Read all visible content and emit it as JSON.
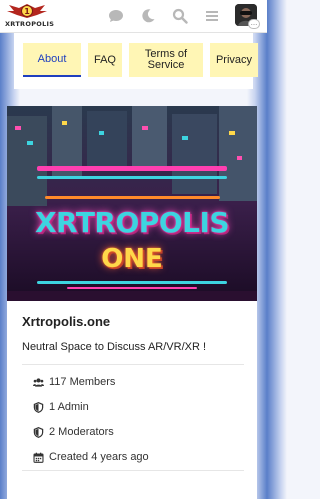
{
  "header": {
    "logo_text": "XRTROPOLIS",
    "icons": [
      "chat-icon",
      "moon-icon",
      "search-icon",
      "hamburger-menu-icon"
    ],
    "avatar_badge": "…"
  },
  "nav": {
    "tabs": [
      {
        "label": "About",
        "active": true
      },
      {
        "label": "FAQ",
        "active": false
      },
      {
        "label": "Terms of Service",
        "active": false
      },
      {
        "label": "Privacy",
        "active": false
      }
    ]
  },
  "banner": {
    "title": "XRTROPOLIS",
    "subtitle": "ONE"
  },
  "about": {
    "site_name": "Xrtropolis.one",
    "description": "Neutral Space to Discuss AR/VR/XR !",
    "stats": {
      "members": "117 Members",
      "admins": "1 Admin",
      "moderators": "2 Moderators",
      "created": "Created 4 years ago"
    }
  },
  "colors": {
    "accent": "#1f3fbf",
    "tab_background": "#fff6b5",
    "banner_cyan": "#3dd4e0",
    "banner_magenta": "#ff3fb0",
    "banner_yellow": "#ffd84a"
  }
}
